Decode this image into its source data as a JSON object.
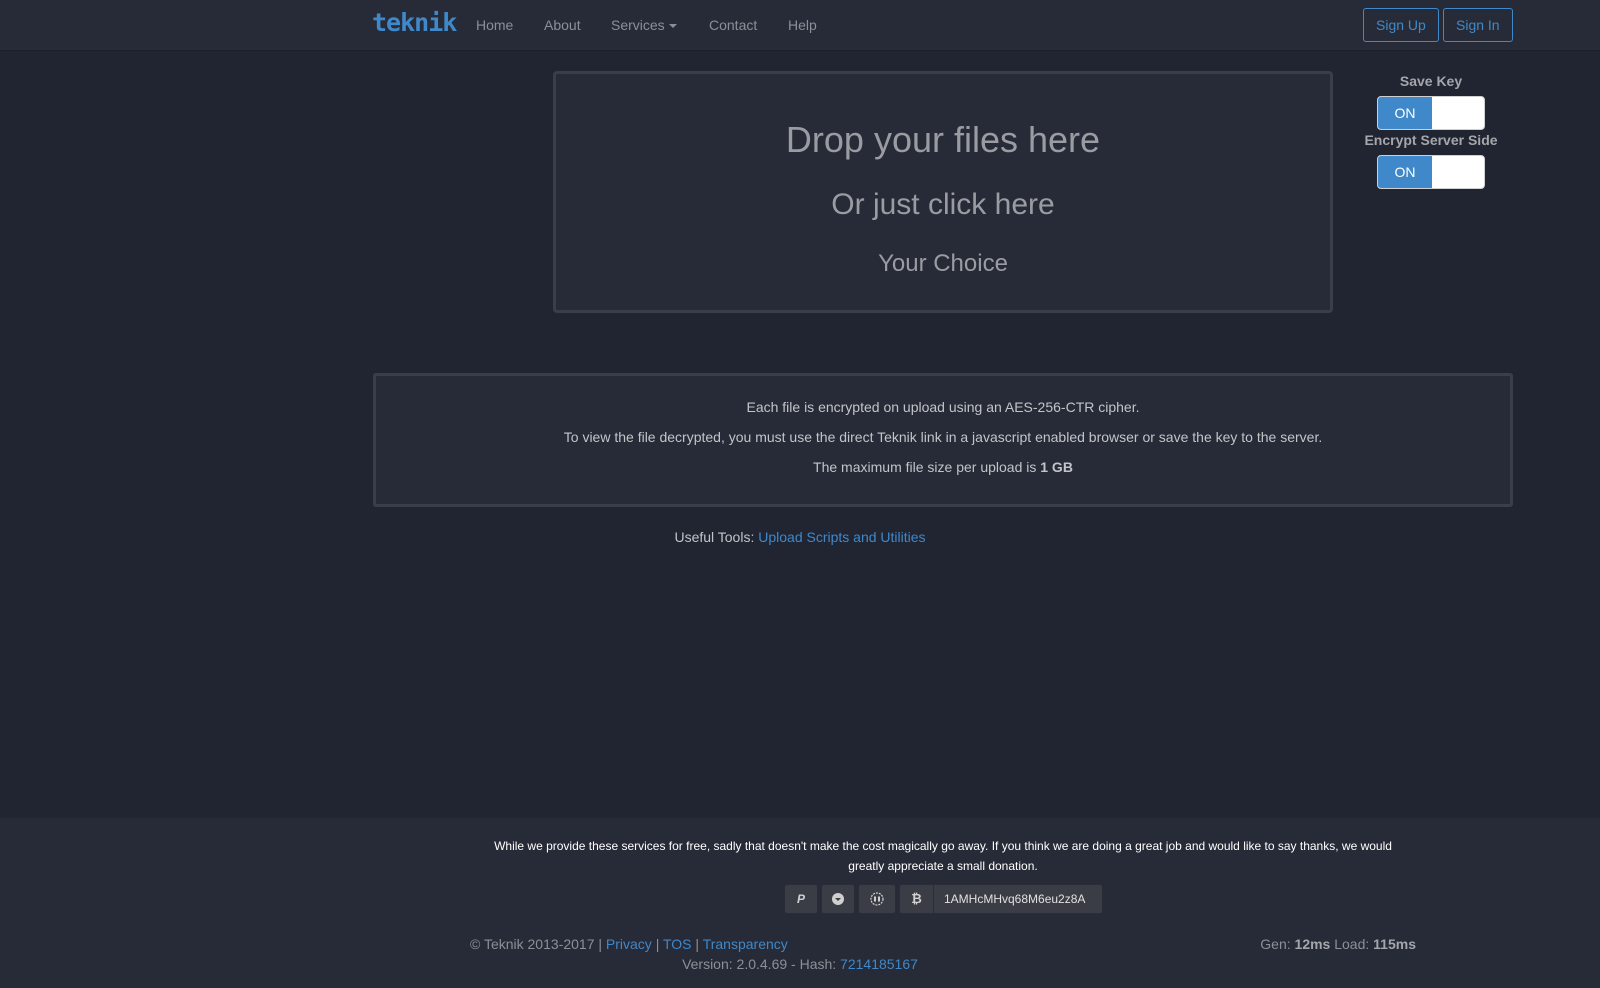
{
  "nav": {
    "brand": "teknik",
    "items": [
      {
        "label": "Home"
      },
      {
        "label": "About"
      },
      {
        "label": "Services"
      },
      {
        "label": "Contact"
      },
      {
        "label": "Help"
      }
    ],
    "signup": "Sign Up",
    "signin": "Sign In"
  },
  "dropzone": {
    "line1": "Drop your files here",
    "line2": "Or just click here",
    "line3": "Your Choice"
  },
  "toggles": [
    {
      "label": "Save Key",
      "state": "ON"
    },
    {
      "label": "Encrypt Server Side",
      "state": "ON"
    }
  ],
  "info": {
    "line1": "Each file is encrypted on upload using an AES-256-CTR cipher.",
    "line2": "To view the file decrypted, you must use the direct Teknik link in a javascript enabled browser or save the key to the server.",
    "line3_prefix": "The maximum file size per upload is ",
    "line3_value": "1 GB"
  },
  "tools": {
    "prefix": "Useful Tools: ",
    "link": "Upload Scripts and Utilities"
  },
  "footer": {
    "donate_text": "While we provide these services for free, sadly that doesn't make the cost magically go away. If you think we are doing a great job and would like to say thanks, we would greatly appreciate a small donation.",
    "donate_icons": [
      "paypal-icon",
      "donate-icon",
      "flattr-icon",
      "bitcoin-icon"
    ],
    "bitcoin_address": "1AMHcMHvq68M6eu2z8A",
    "copyright": "© Teknik 2013-2017 | ",
    "privacy": "Privacy",
    "sep": " | ",
    "tos": "TOS",
    "transparency": "Transparency",
    "gen_label": "Gen: ",
    "gen_value": "12ms",
    "load_label": " Load: ",
    "load_value": "115ms",
    "version_prefix": "Version: 2.0.4.69 - Hash: ",
    "hash": "7214185167"
  },
  "colors": {
    "accent": "#3f88c9",
    "background": "#212532",
    "panel": "#272b37"
  }
}
